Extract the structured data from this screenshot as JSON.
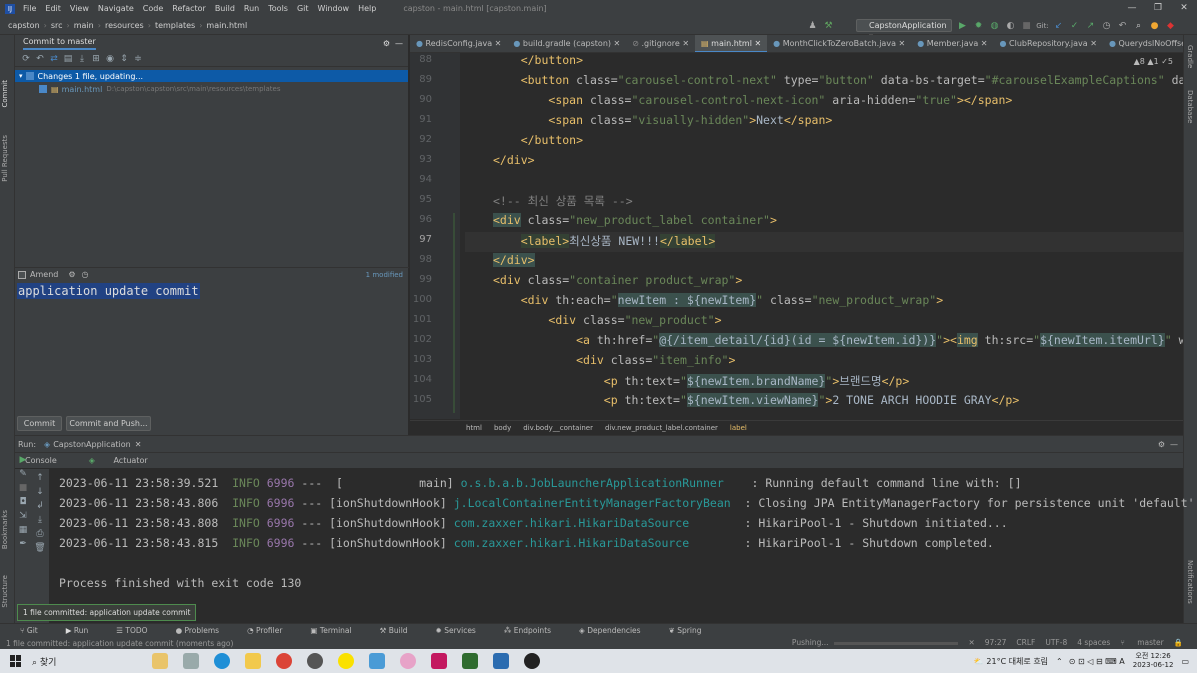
{
  "menubar": {
    "items": [
      "File",
      "Edit",
      "View",
      "Navigate",
      "Code",
      "Refactor",
      "Build",
      "Run",
      "Tools",
      "Git",
      "Window",
      "Help"
    ],
    "title": "capston - main.html [capston.main]"
  },
  "navbar": {
    "crumbs": [
      "capston",
      "src",
      "main",
      "resources",
      "templates",
      "main.html"
    ],
    "run_config": "CapstonApplication"
  },
  "left_toolbar": [
    "Commit",
    "Pull Requests",
    "Bookmarks",
    "Structure"
  ],
  "right_toolbar": [
    "Gradle",
    "Database",
    "Notifications"
  ],
  "commit_panel": {
    "title": "Commit to master",
    "changes_label": "Changes 1 file, updating...",
    "file_name": "main.html",
    "file_path": "D:\\capston\\capston\\src\\main\\resources\\templates",
    "amend_label": "Amend",
    "modified_count": "1 modified",
    "commit_message": "application update commit",
    "commit_button": "Commit",
    "commit_push_button": "Commit and Push..."
  },
  "editor": {
    "tabs": [
      "RedisConfig.java",
      "build.gradle (capston)",
      ".gitignore",
      "main.html",
      "MonthClickToZeroBatch.java",
      "Member.java",
      "ClubRepository.java",
      "QuerydslNoOffsetOptions.java"
    ],
    "active_tab": "main.html",
    "inspections": "▲8 ▲1 ✓5",
    "line_numbers": [
      "88",
      "89",
      "90",
      "91",
      "92",
      "93",
      "94",
      "95",
      "96",
      "97",
      "98",
      "99",
      "100",
      "101",
      "102",
      "103",
      "104",
      "105"
    ],
    "breadcrumb": [
      "html",
      "body",
      "div.body__container",
      "div.new_product_label.container",
      "label"
    ]
  },
  "run_panel": {
    "label": "Run:",
    "app": "CapstonApplication",
    "tabs": [
      "Console",
      "Actuator"
    ],
    "logs": [
      {
        "ts": "2023-06-11 23:58:39.521",
        "level": "INFO",
        "pid": "6996",
        "thread": "---  [           main]",
        "logger": "o.s.b.a.b.JobLauncherApplicationRunner  ",
        "msg": " : Running default command line with: []"
      },
      {
        "ts": "2023-06-11 23:58:43.806",
        "level": "INFO",
        "pid": "6996",
        "thread": "--- [ionShutdownHook]",
        "logger": "j.LocalContainerEntityManagerFactoryBean",
        "msg": " : Closing JPA EntityManagerFactory for persistence unit 'default'"
      },
      {
        "ts": "2023-06-11 23:58:43.808",
        "level": "INFO",
        "pid": "6996",
        "thread": "--- [ionShutdownHook]",
        "logger": "com.zaxxer.hikari.HikariDataSource      ",
        "msg": " : HikariPool-1 - Shutdown initiated..."
      },
      {
        "ts": "2023-06-11 23:58:43.815",
        "level": "INFO",
        "pid": "6996",
        "thread": "--- [ionShutdownHook]",
        "logger": "com.zaxxer.hikari.HikariDataSource      ",
        "msg": " : HikariPool-1 - Shutdown completed."
      }
    ],
    "exit_line": "Process finished with exit code 130"
  },
  "toast": "1 file committed: application update commit",
  "bottom_tabs": [
    "Git",
    "Run",
    "TODO",
    "Problems",
    "Profiler",
    "Terminal",
    "Build",
    "Services",
    "Endpoints",
    "Dependencies",
    "Spring"
  ],
  "status": {
    "left": "1 file committed: application update commit (moments ago)",
    "pushing": "Pushing...",
    "position": "97:27",
    "line_sep": "CRLF",
    "encoding": "UTF-8",
    "indent": "4 spaces",
    "branch": "master"
  },
  "taskbar": {
    "search": "찾기",
    "weather": "21°C 대체로 흐림",
    "time": "오전 12:26",
    "date": "2023-06-12"
  }
}
